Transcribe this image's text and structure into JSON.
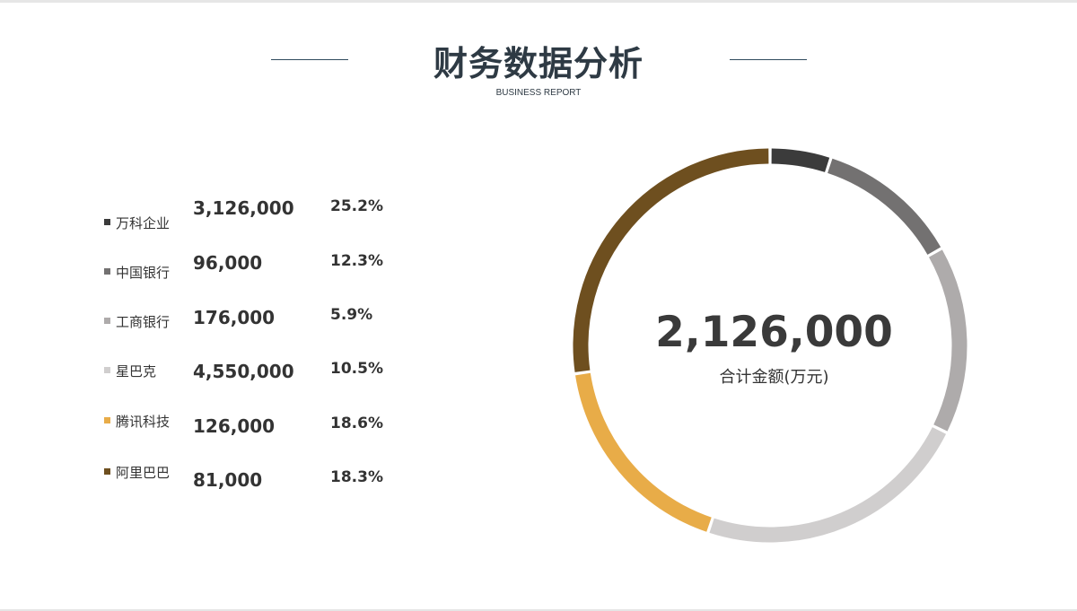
{
  "header": {
    "title": "财务数据分析",
    "subtitle": "BUSINESS REPORT"
  },
  "chart_data": {
    "type": "pie",
    "categories": [
      "万科企业",
      "中国银行",
      "工商银行",
      "星巴克",
      "腾讯科技",
      "阿里巴巴"
    ],
    "values": [
      3126000,
      96000,
      176000,
      4550000,
      126000,
      81000
    ],
    "value_labels": [
      "3,126,000",
      "96,000",
      "176,000",
      "4,550,000",
      "126,000",
      "81,000"
    ],
    "percent_labels": [
      "25.2%",
      "12.3%",
      "5.9%",
      "10.5%",
      "18.6%",
      "18.3%"
    ],
    "ring_shares": [
      5.0,
      11.8,
      15.5,
      22.8,
      17.6,
      27.3
    ],
    "colors": [
      "#3b3b3b",
      "#737171",
      "#aeabab",
      "#d0cece",
      "#e8ac48",
      "#6e4f1f"
    ],
    "center_value": "2,126,000",
    "center_label": "合计金额(万元)",
    "legend_position": "left"
  }
}
